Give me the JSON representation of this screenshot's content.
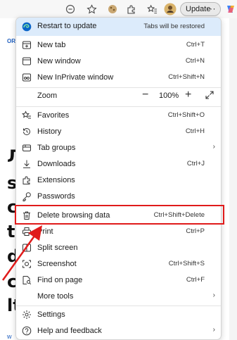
{
  "toolbar": {
    "icons": [
      "reader-icon",
      "favorite-star-icon",
      "extension-icon",
      "extensions-puzzle-icon",
      "favorites-bar-icon",
      "profile-avatar",
      "copilot-icon"
    ],
    "update_label": "Update",
    "more_label": "···"
  },
  "background": {
    "logo_fragment": "OR",
    "letters": [
      "Л",
      "s",
      "c",
      "t",
      "d",
      "c",
      "lt"
    ],
    "link_fragment": "w"
  },
  "menu": {
    "restart": {
      "label": "Restart to update",
      "note": "Tabs will be restored",
      "color": "#dcebfb"
    },
    "items": [
      {
        "label": "New tab",
        "shortcut": "Ctrl+T"
      },
      {
        "label": "New window",
        "shortcut": "Ctrl+N"
      },
      {
        "label": "New InPrivate window",
        "shortcut": "Ctrl+Shift+N"
      },
      {
        "label": "Zoom",
        "value": "100%"
      },
      {
        "label": "Favorites",
        "shortcut": "Ctrl+Shift+O"
      },
      {
        "label": "History",
        "shortcut": "Ctrl+H"
      },
      {
        "label": "Tab groups",
        "shortcut": ""
      },
      {
        "label": "Downloads",
        "shortcut": "Ctrl+J"
      },
      {
        "label": "Extensions",
        "shortcut": ""
      },
      {
        "label": "Passwords",
        "shortcut": ""
      },
      {
        "label": "Delete browsing data",
        "shortcut": "Ctrl+Shift+Delete"
      },
      {
        "label": "Print",
        "shortcut": "Ctrl+P"
      },
      {
        "label": "Split screen",
        "shortcut": ""
      },
      {
        "label": "Screenshot",
        "shortcut": "Ctrl+Shift+S"
      },
      {
        "label": "Find on page",
        "shortcut": "Ctrl+F"
      },
      {
        "label": "More tools",
        "shortcut": ""
      },
      {
        "label": "Settings",
        "shortcut": ""
      },
      {
        "label": "Help and feedback",
        "shortcut": ""
      }
    ]
  },
  "colors": {
    "highlight": "#e01b1b",
    "accent": "#0a64c8"
  }
}
